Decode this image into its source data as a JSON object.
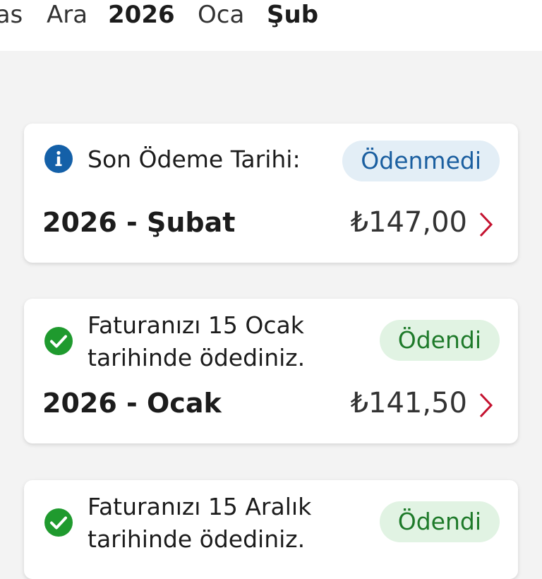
{
  "month_tabs": [
    {
      "label": "Kas",
      "bold": false
    },
    {
      "label": "Ara",
      "bold": false
    },
    {
      "label": "2026",
      "bold": true
    },
    {
      "label": "Oca",
      "bold": false
    },
    {
      "label": "Şub",
      "bold": true
    }
  ],
  "bills": [
    {
      "status_icon": "info-icon",
      "message_lines": [
        "Son Ödeme Tarihi:"
      ],
      "status_label": "Ödenmedi",
      "status": "unpaid",
      "period": "2026 - Şubat",
      "amount": "₺147,00"
    },
    {
      "status_icon": "check-circle-icon",
      "message_lines": [
        "Faturanızı 15 Ocak",
        "tarihinde ödediniz."
      ],
      "status_label": "Ödendi",
      "status": "paid",
      "period": "2026 - Ocak",
      "amount": "₺141,50"
    },
    {
      "status_icon": "check-circle-icon",
      "message_lines": [
        "Faturanızı 15 Aralık",
        "tarihinde ödediniz."
      ],
      "status_label": "Ödendi",
      "status": "paid"
    }
  ],
  "colors": {
    "info_blue": "#1460a8",
    "paid_green": "#1f9a2e",
    "chevron_red": "#c4122f",
    "unpaid_badge_bg": "#e3eef6",
    "paid_badge_bg": "#e1f3e3"
  }
}
